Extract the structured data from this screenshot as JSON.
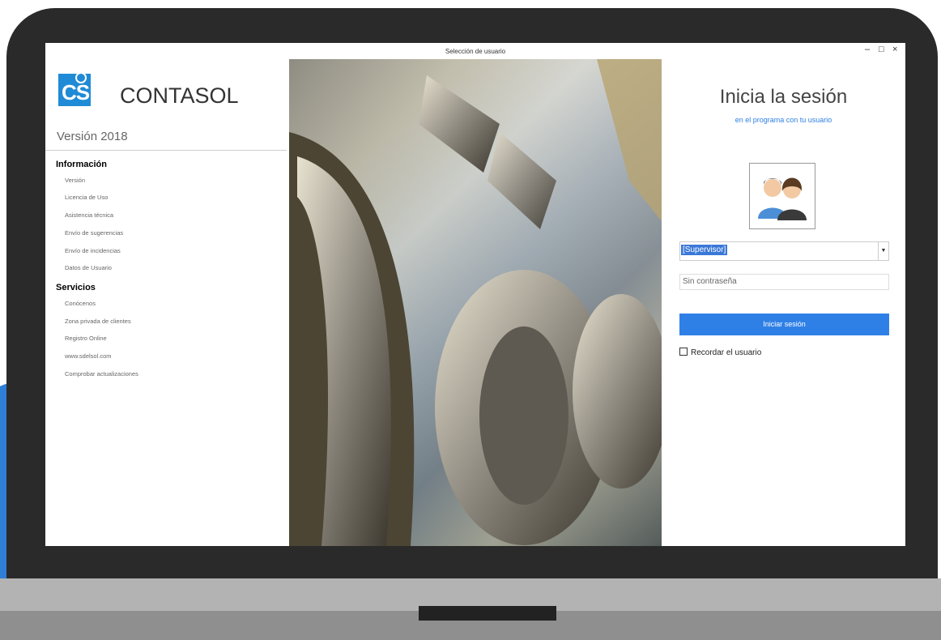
{
  "window": {
    "title": "Selección de usuario",
    "minimize_glyph": "–",
    "maximize_glyph": "□",
    "close_glyph": "×"
  },
  "left_panel": {
    "logo_text": "CS",
    "brand": "CONTASOL",
    "version": "Versión 2018",
    "sections": [
      {
        "heading": "Información",
        "items": [
          "Versión",
          "Licencia de Uso",
          "Asistencia técnica",
          "Envío de sugerencias",
          "Envío de incidencias",
          "Datos de Usuario"
        ]
      },
      {
        "heading": "Servicios",
        "items": [
          "Conócenos",
          "Zona privada de clientes",
          "Registro Online",
          "www.sdelsol.com",
          "Comprobar actualizaciones"
        ]
      }
    ]
  },
  "login": {
    "title": "Inicia la sesión",
    "subtitle": "en el programa con tu usuario",
    "user_value": "[Supervisor]",
    "password_placeholder": "Sin contraseña",
    "submit_label": "Iniciar sesión",
    "remember_label": "Recordar el usuario"
  },
  "colors": {
    "accent": "#2f80e6",
    "logo": "#1f8bd6",
    "laptop_frame": "#2a2a2a"
  },
  "icons": {
    "avatar": "users-icon",
    "dropdown": "chevron-down-icon"
  }
}
